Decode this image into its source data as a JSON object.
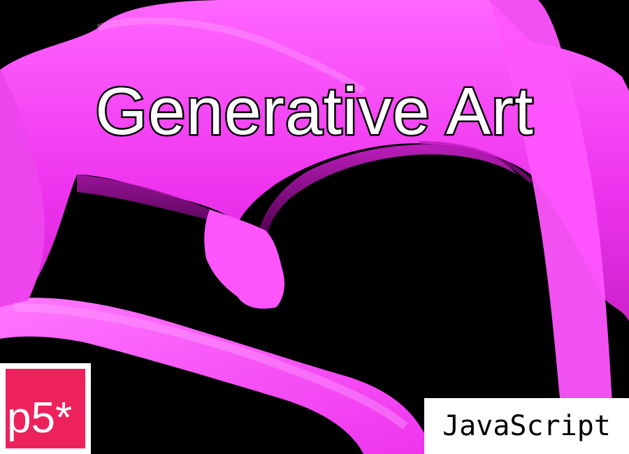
{
  "title": "Generative Art",
  "logo": {
    "text": "p5*",
    "color": "#ed225d"
  },
  "badge": {
    "text": "JavaScript"
  },
  "colors": {
    "background": "#000000",
    "stroke": "#ff44ff"
  }
}
